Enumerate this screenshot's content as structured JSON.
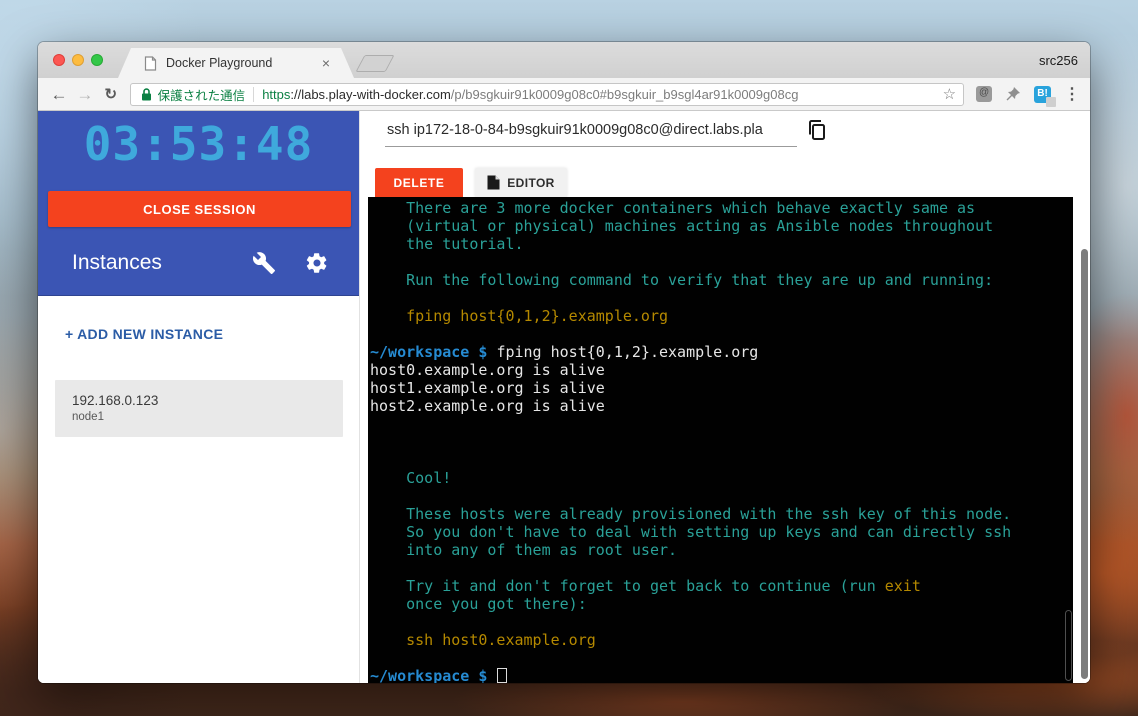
{
  "chrome": {
    "profile_label": "src256",
    "tab": {
      "title": "Docker Playground",
      "close_glyph": "×"
    },
    "nav": {
      "back_glyph": "←",
      "forward_glyph": "→",
      "reload_glyph": "↻"
    },
    "urlbar": {
      "security_label": "保護された通信",
      "url_scheme": "https",
      "url_host": "://labs.play-with-docker.com",
      "url_path": "/p/b9sgkuir91k0009g08c0#b9sgkuir_b9sgl4ar91k0009g08cg",
      "star_glyph": "☆"
    },
    "menu_glyph": "⋮"
  },
  "sidebar": {
    "timer": "03:53:48",
    "close_session_label": "CLOSE SESSION",
    "instances_title": "Instances",
    "add_instance_label": "+ ADD NEW INSTANCE",
    "instances": [
      {
        "ip": "192.168.0.123",
        "name": "node1"
      }
    ]
  },
  "main": {
    "ssh_command": "ssh ip172-18-0-84-b9sgkuir91k0009g08c0@direct.labs.pla",
    "delete_label": "DELETE",
    "editor_label": "EDITOR"
  },
  "terminal": {
    "lines": [
      [
        {
          "s": "    There are 3 more docker containers which behave exactly same as",
          "c": "info"
        }
      ],
      [
        {
          "s": "    (virtual or physical) machines acting as Ansible nodes throughout",
          "c": "info"
        }
      ],
      [
        {
          "s": "    the tutorial.",
          "c": "info"
        }
      ],
      [],
      [
        {
          "s": "    Run the following command to verify that they are up and running:",
          "c": "info"
        }
      ],
      [],
      [
        {
          "s": "    fping host{0,1,2}.example.org",
          "c": "cmd"
        }
      ],
      [],
      [
        {
          "s": "~/workspace $ ",
          "c": "prompt"
        },
        {
          "s": "fping host{0,1,2}.example.org",
          "c": "out"
        }
      ],
      [
        {
          "s": "host0.example.org is alive",
          "c": "out"
        }
      ],
      [
        {
          "s": "host1.example.org is alive",
          "c": "out"
        }
      ],
      [
        {
          "s": "host2.example.org is alive",
          "c": "out"
        }
      ],
      [],
      [],
      [],
      [
        {
          "s": "    Cool!",
          "c": "info"
        }
      ],
      [],
      [
        {
          "s": "    These hosts were already provisioned with the ssh key of this node.",
          "c": "info"
        }
      ],
      [
        {
          "s": "    So you don't have to deal with setting up keys and can directly ssh",
          "c": "info"
        }
      ],
      [
        {
          "s": "    into any of them as root user.",
          "c": "info"
        }
      ],
      [],
      [
        {
          "s": "    Try it and don't forget to get back to continue (run ",
          "c": "info"
        },
        {
          "s": "exit",
          "c": "cmd"
        }
      ],
      [
        {
          "s": "    once you got there):",
          "c": "info"
        }
      ],
      [],
      [
        {
          "s": "    ssh host0.example.org",
          "c": "cmd"
        }
      ],
      [],
      [
        {
          "s": "~/workspace $ ",
          "c": "prompt"
        },
        {
          "cursor": true
        }
      ]
    ]
  },
  "colors": {
    "sidebar_blue": "#3b55b4",
    "timer_blue": "#3fa9dc",
    "action_red": "#f4421e",
    "link_blue": "#2b5ca6",
    "term_info": "#2aa198",
    "term_cmd": "#b58900",
    "term_prompt": "#268bd2",
    "term_out": "#e6e6e6"
  }
}
